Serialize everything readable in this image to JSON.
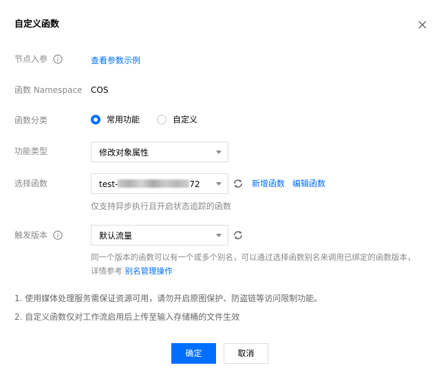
{
  "dialog": {
    "title": "自定义函数",
    "close_icon": "close-icon"
  },
  "fields": {
    "input_param": {
      "label": "节点入参",
      "link": "查看参数示例"
    },
    "namespace": {
      "label": "函数 Namespace",
      "value": "COS"
    },
    "category": {
      "label": "函数分类",
      "options": [
        {
          "label": "常用功能",
          "selected": true
        },
        {
          "label": "自定义",
          "selected": false
        }
      ]
    },
    "feature_type": {
      "label": "功能类型",
      "value": "修改对象属性"
    },
    "select_function": {
      "label": "选择函数",
      "value_prefix": "test-",
      "value_suffix": "72",
      "add_link": "新增函数",
      "edit_link": "编辑函数",
      "hint": "仅支持异步执行且开启状态追踪的函数"
    },
    "trigger_version": {
      "label": "触发版本",
      "value": "默认流量",
      "hint_text": "同一个版本的函数可以有一个或多个别名，可以通过选择函数别名来调用已绑定的函数版本，详情参考",
      "hint_link": "别名管理操作"
    }
  },
  "notes": [
    "1. 使用媒体处理服务需保证资源可用，请勿开启原图保护、防盗链等访问限制功能。",
    "2. 自定义函数仅对工作流启用后上传至输入存储桶的文件生效"
  ],
  "buttons": {
    "confirm": "确定",
    "cancel": "取消"
  },
  "colors": {
    "accent": "#006eff",
    "label": "#888888",
    "border": "#dddddd"
  }
}
